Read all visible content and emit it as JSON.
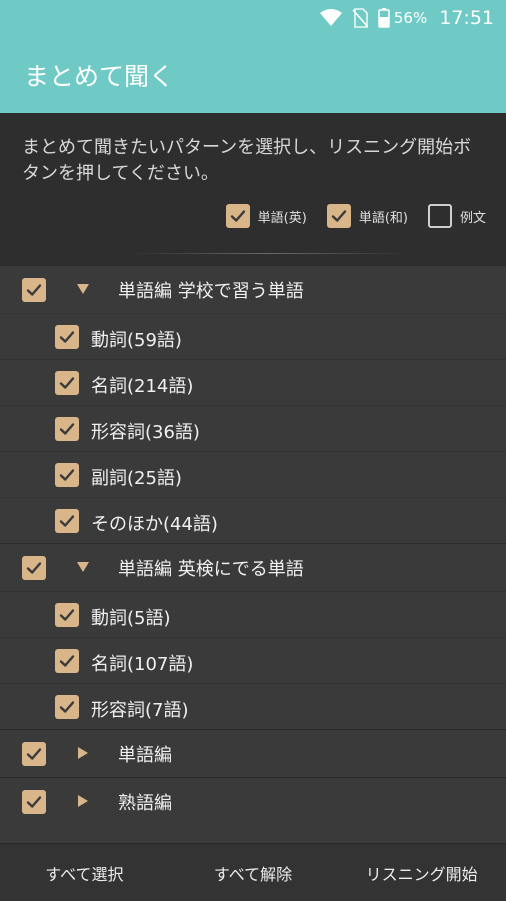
{
  "status_bar": {
    "battery_percent": "56%",
    "time": "17:51",
    "icons": [
      "wifi-icon",
      "no-sim-icon",
      "battery-icon"
    ]
  },
  "app_bar": {
    "title": "まとめて聞く"
  },
  "instruction": {
    "text": "まとめて聞きたいパターンを選択し、リスニング開始ボタンを押してください。",
    "options": [
      {
        "label": "単語(英)",
        "checked": true
      },
      {
        "label": "単語(和)",
        "checked": true
      },
      {
        "label": "例文",
        "checked": false
      }
    ]
  },
  "groups": [
    {
      "label": "単語編 学校で習う単語",
      "checked": true,
      "expanded": true,
      "items": [
        {
          "label": "動詞(59語)",
          "checked": true
        },
        {
          "label": "名詞(214語)",
          "checked": true
        },
        {
          "label": "形容詞(36語)",
          "checked": true
        },
        {
          "label": "副詞(25語)",
          "checked": true
        },
        {
          "label": "そのほか(44語)",
          "checked": true
        }
      ]
    },
    {
      "label": "単語編 英検にでる単語",
      "checked": true,
      "expanded": true,
      "items": [
        {
          "label": "動詞(5語)",
          "checked": true
        },
        {
          "label": "名詞(107語)",
          "checked": true
        },
        {
          "label": "形容詞(7語)",
          "checked": true
        }
      ]
    },
    {
      "label": "単語編",
      "checked": true,
      "expanded": false,
      "items": []
    },
    {
      "label": "熟語編",
      "checked": true,
      "expanded": false,
      "items": []
    }
  ],
  "bottom_bar": {
    "select_all": "すべて選択",
    "deselect_all": "すべて解除",
    "start_listening": "リスニング開始"
  },
  "colors": {
    "accent": "#6fcac6",
    "checkbox": "#d9b58a",
    "background": "#3a3a3a",
    "panel": "#2e2e2e"
  }
}
